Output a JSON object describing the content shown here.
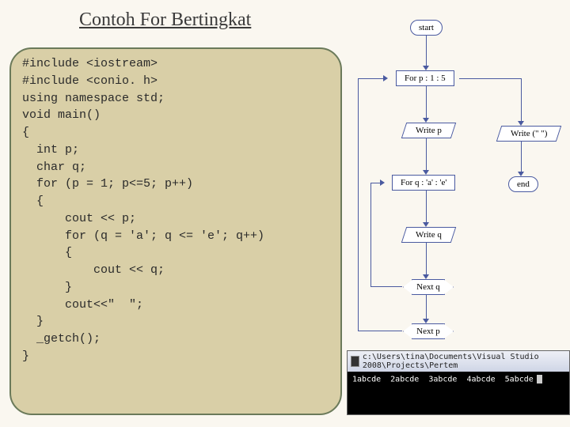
{
  "title": "Contoh For Bertingkat",
  "code": "#include <iostream>\n#include <conio. h>\nusing namespace std;\nvoid main()\n{\n  int p;\n  char q;\n  for (p = 1; p<=5; p++)\n  {\n      cout << p;\n      for (q = 'a'; q <= 'e'; q++)\n      {\n          cout << q;\n      }\n      cout<<\"  \";\n  }\n  _getch();\n}",
  "flow": {
    "start": "start",
    "for_p": "For p : 1 : 5",
    "write_p": "Write p",
    "for_q": "For q : 'a' : 'e'",
    "write_q": "Write q",
    "next_q": "Next q",
    "next_p": "Next p",
    "write_spaces": "Write (\"  \")",
    "end": "end"
  },
  "console": {
    "title": "c:\\Users\\tina\\Documents\\Visual Studio 2008\\Projects\\Pertem",
    "output": "1abcde  2abcde  3abcde  4abcde  5abcde"
  }
}
